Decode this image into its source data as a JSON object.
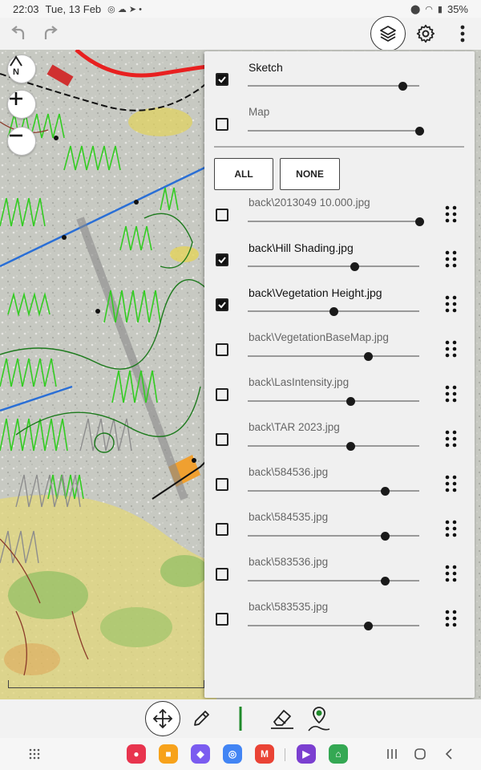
{
  "status_bar": {
    "time": "22:03",
    "date": "Tue, 13 Feb",
    "battery": "35%"
  },
  "icons": {
    "undo": "undo-arrow-icon",
    "redo": "redo-arrow-icon",
    "layers": "layers-stack-icon",
    "settings": "gear-icon",
    "more": "vertical-dots-icon",
    "north": "north-arrow-icon",
    "zoom_in": "plus-icon",
    "zoom_out": "minus-icon",
    "move": "four-way-arrow-icon",
    "pencil": "pencil-icon",
    "eraser": "eraser-icon",
    "pin": "map-pin-track-icon"
  },
  "map_controls": {
    "north_label": "N"
  },
  "layers_panel": {
    "top_layers": [
      {
        "name": "Sketch",
        "checked": true,
        "opacity": 0.9
      },
      {
        "name": "Map",
        "checked": false,
        "opacity": 1.0
      }
    ],
    "all_label": "ALL",
    "none_label": "NONE",
    "background_layers": [
      {
        "name": "back\\2013049 10.000.jpg",
        "checked": false,
        "opacity": 1.0
      },
      {
        "name": "back\\Hill Shading.jpg",
        "checked": true,
        "opacity": 0.62
      },
      {
        "name": "back\\Vegetation Height.jpg",
        "checked": true,
        "opacity": 0.5
      },
      {
        "name": "back\\VegetationBaseMap.jpg",
        "checked": false,
        "opacity": 0.7
      },
      {
        "name": "back\\LasIntensity.jpg",
        "checked": false,
        "opacity": 0.6
      },
      {
        "name": "back\\TAR 2023.jpg",
        "checked": false,
        "opacity": 0.6
      },
      {
        "name": "back\\584536.jpg",
        "checked": false,
        "opacity": 0.8
      },
      {
        "name": "back\\584535.jpg",
        "checked": false,
        "opacity": 0.8
      },
      {
        "name": "back\\583536.jpg",
        "checked": false,
        "opacity": 0.8
      },
      {
        "name": "back\\583535.jpg",
        "checked": false,
        "opacity": 0.7
      }
    ]
  },
  "colors": {
    "line_tool": "#1f8a2a",
    "pin_tool": "#1f8a2a",
    "map_red_line": "#e82020",
    "map_green": "#33cc22",
    "map_blue_line": "#2a6fd6"
  },
  "nav_bar": {
    "apps": [
      {
        "name": "Screen recorder",
        "color": "#e8344e"
      },
      {
        "name": "My Files",
        "color": "#f7a21b"
      },
      {
        "name": "Messages",
        "color": "#7b5cf0"
      },
      {
        "name": "Chrome",
        "color": "#4285f4"
      },
      {
        "name": "Gmail",
        "color": "#ea4335"
      },
      {
        "name": "Player",
        "color": "#7b3fd0"
      },
      {
        "name": "Google Home",
        "color": "#34a853"
      }
    ]
  }
}
